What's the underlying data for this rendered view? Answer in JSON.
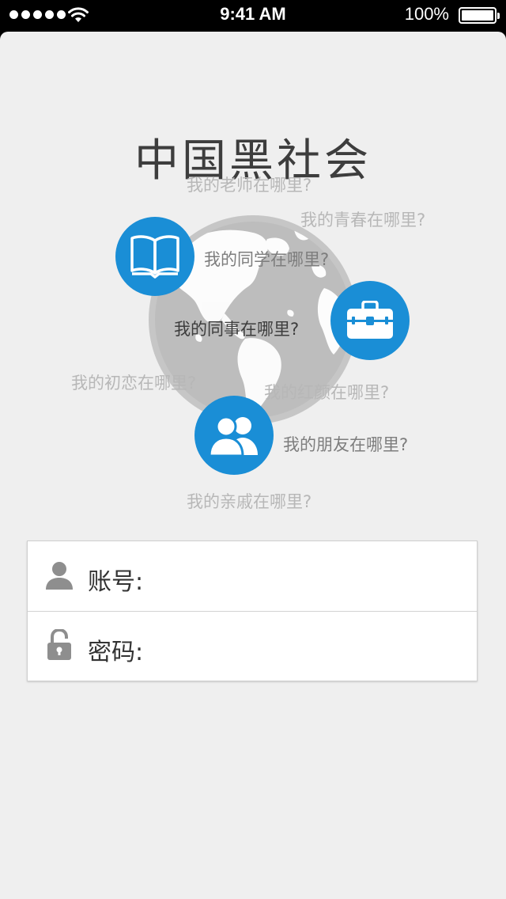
{
  "status_bar": {
    "time": "9:41 AM",
    "battery_percent": "100%",
    "battery_level": 1.0,
    "signal_bars": 5
  },
  "app": {
    "title": "中国黑社会",
    "questions": {
      "teacher": "我的老师在哪里?",
      "youth": "我的青春在哪里?",
      "classmate": "我的同学在哪里?",
      "colleague": "我的同事在哪里?",
      "first_love": "我的初恋在哪里?",
      "confidante": "我的红颜在哪里?",
      "friend": "我的朋友在哪里?",
      "relatives": "我的亲戚在哪里?"
    },
    "icons": {
      "classmate": "book-icon",
      "colleague": "briefcase-icon",
      "friend": "people-icon"
    }
  },
  "login": {
    "account_label": "账号:",
    "account_value": "",
    "password_label": "密码:",
    "password_value": ""
  },
  "colors": {
    "accent_blue": "#1a8ed6",
    "background": "#efefef",
    "globe_gray": "#bfbfbf",
    "title_text": "#3d3d3d"
  }
}
